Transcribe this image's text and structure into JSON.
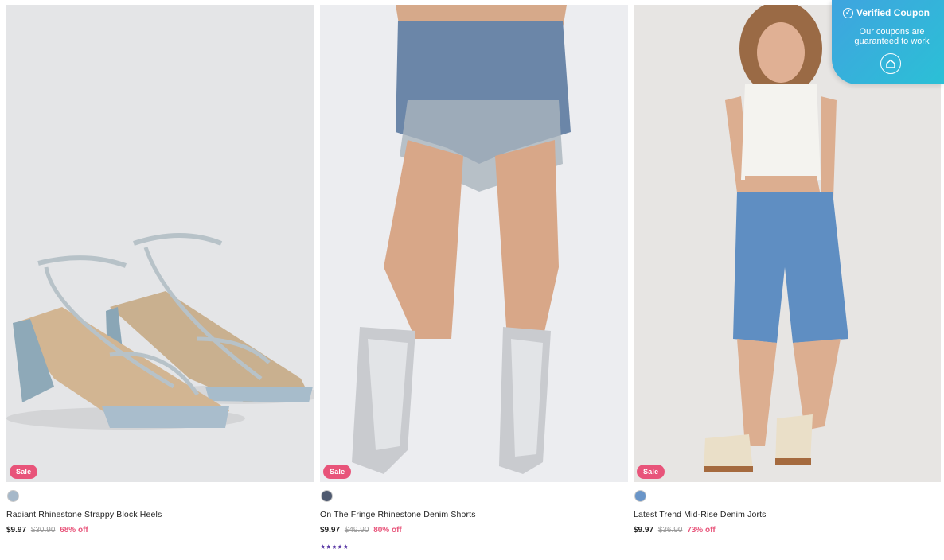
{
  "products": [
    {
      "name": "Radiant Rhinestone Strappy Block Heels",
      "badge": "Sale",
      "price": "$9.97",
      "original_price": "$30.90",
      "discount": "68% off",
      "swatch_color": "#a6b8c9",
      "rating_stars": ""
    },
    {
      "name": "On The Fringe Rhinestone Denim Shorts",
      "badge": "Sale",
      "price": "$9.97",
      "original_price": "$49.90",
      "discount": "80% off",
      "swatch_color": "#4f5a70",
      "rating_stars": "★★★★★"
    },
    {
      "name": "Latest Trend Mid-Rise Denim Jorts",
      "badge": "Sale",
      "price": "$9.97",
      "original_price": "$36.90",
      "discount": "73% off",
      "swatch_color": "#6a95c8",
      "rating_stars": ""
    }
  ],
  "coupon_widget": {
    "title": "Verified Coupon",
    "message": "Our coupons are guaranteed to work",
    "icon": "home-icon",
    "check_icon": "check-circle-icon"
  },
  "colors": {
    "sale_badge": "#e8547a",
    "discount_text": "#e8547a",
    "rating_stars": "#5b3aa6",
    "coupon_gradient_start": "#3fa4df",
    "coupon_gradient_end": "#2bc0d6"
  }
}
